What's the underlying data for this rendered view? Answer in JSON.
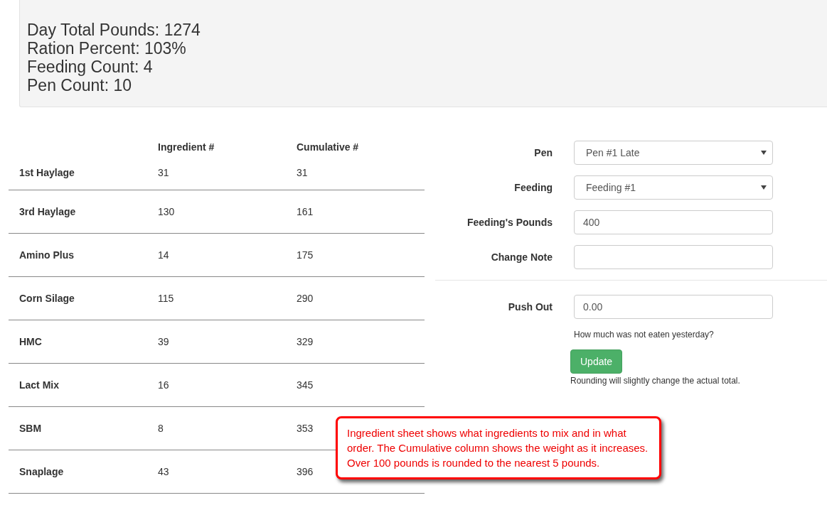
{
  "summary": [
    "Day Total Pounds: 1274",
    "Ration Percent: 103%",
    "Feeding Count: 4",
    "Pen Count: 10"
  ],
  "table": {
    "columns": [
      "Ingredient #",
      "Cumulative #"
    ],
    "rows": [
      {
        "name": "1st Haylage",
        "ingredient": "31",
        "cumulative": "31"
      },
      {
        "name": "3rd Haylage",
        "ingredient": "130",
        "cumulative": "161"
      },
      {
        "name": "Amino Plus",
        "ingredient": "14",
        "cumulative": "175"
      },
      {
        "name": "Corn Silage",
        "ingredient": "115",
        "cumulative": "290"
      },
      {
        "name": "HMC",
        "ingredient": "39",
        "cumulative": "329"
      },
      {
        "name": "Lact Mix",
        "ingredient": "16",
        "cumulative": "345"
      },
      {
        "name": "SBM",
        "ingredient": "8",
        "cumulative": "353"
      },
      {
        "name": "Snaplage",
        "ingredient": "43",
        "cumulative": "396"
      }
    ]
  },
  "form": {
    "fields": [
      {
        "label": "Pen",
        "kind": "select",
        "value": "Pen #1 Late"
      },
      {
        "label": "Feeding",
        "kind": "select",
        "value": "Feeding #1"
      },
      {
        "label": "Feeding's Pounds",
        "kind": "text",
        "value": "400"
      },
      {
        "label": "Change Note",
        "kind": "text"
      }
    ],
    "push_out": {
      "label": "Push Out",
      "value": "0.00",
      "help": "How much was not eaten yesterday?"
    },
    "button": "Update",
    "note": "Rounding will slightly change the actual total."
  },
  "callout": [
    "Ingredient sheet shows what ingredients to mix and in what order. The Cumulative column shows the weight as it increases.",
    "Over 100 pounds is rounded to the nearest 5 pounds."
  ]
}
